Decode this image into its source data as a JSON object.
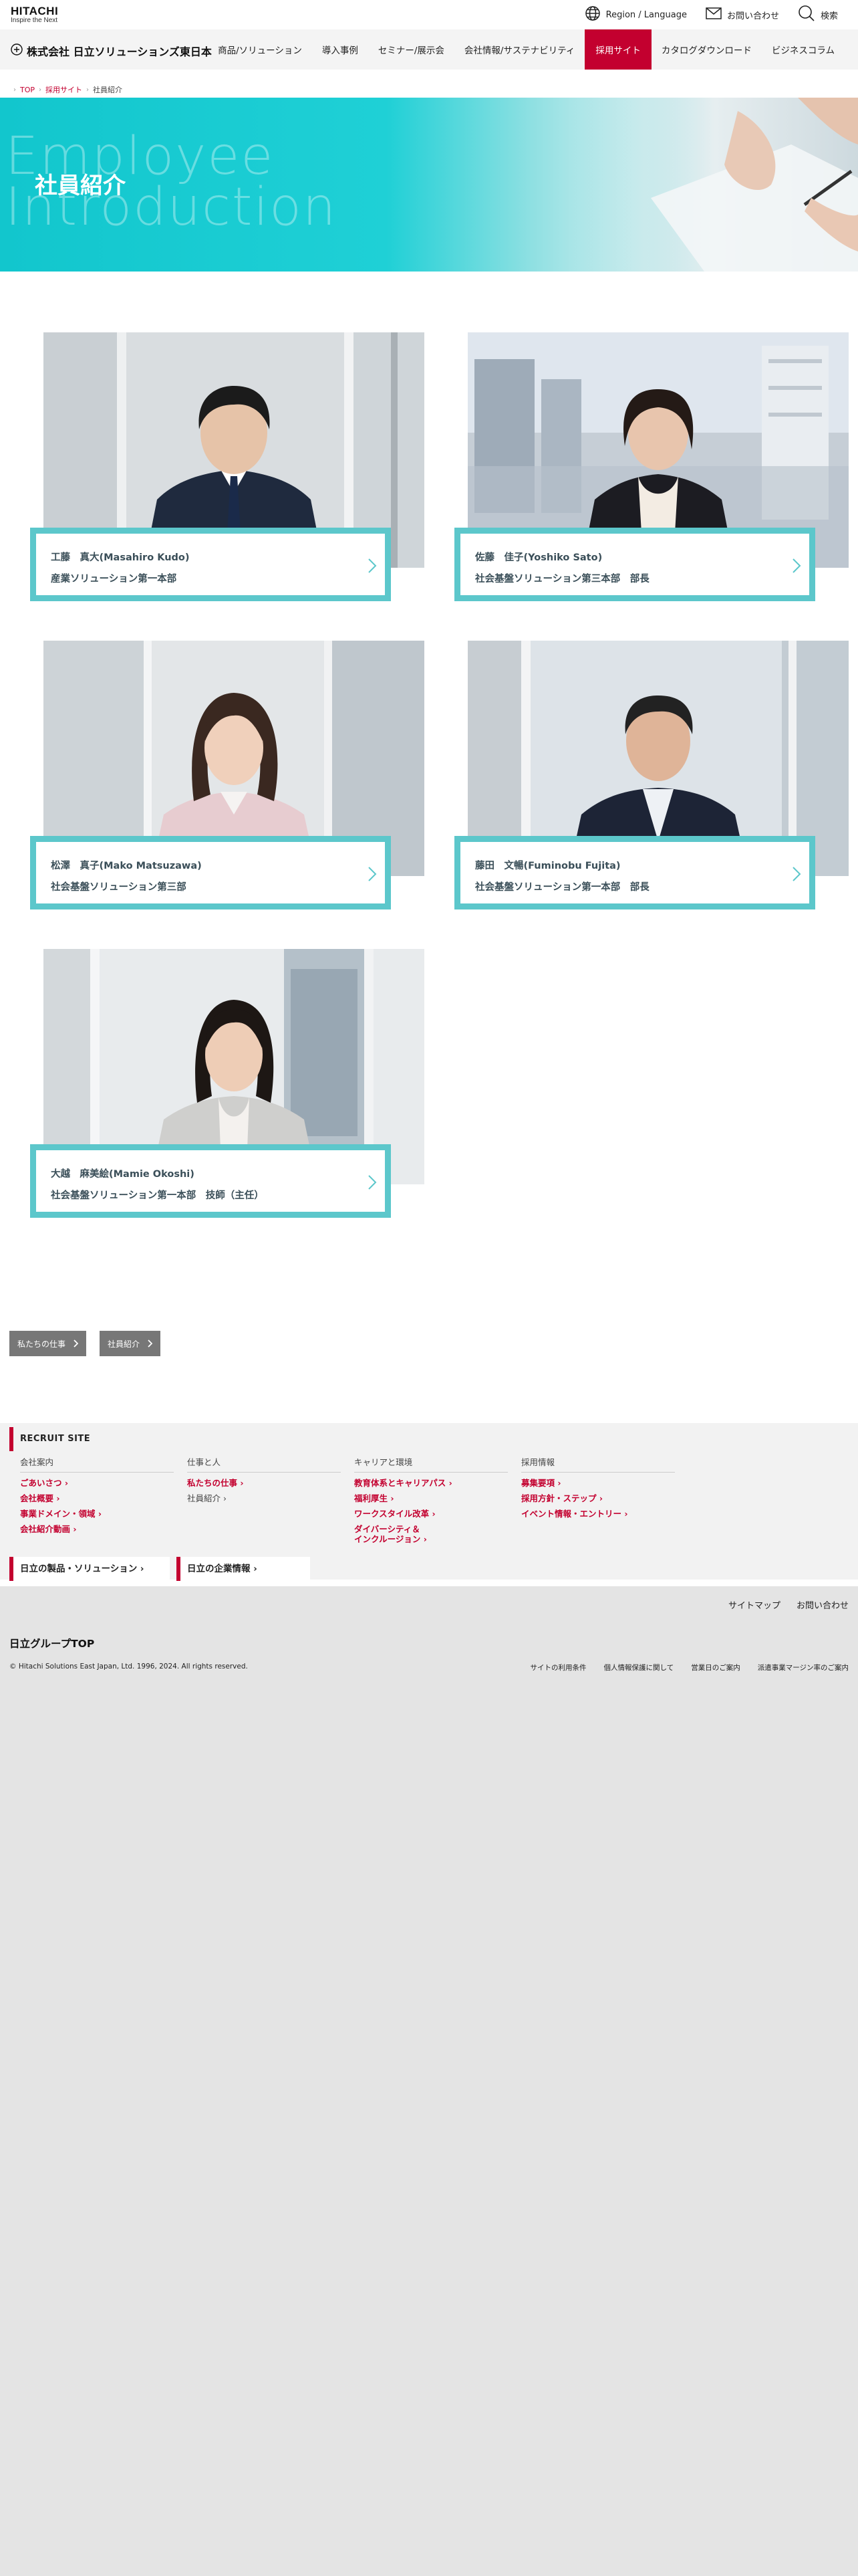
{
  "header": {
    "logo_main": "HITACHI",
    "logo_sub": "Inspire the Next",
    "utils": [
      {
        "label": "Region / Language",
        "icon": "globe-icon"
      },
      {
        "label": "お問い合わせ",
        "icon": "mail-icon"
      },
      {
        "label": "検索",
        "icon": "search-icon"
      }
    ]
  },
  "nav": {
    "company": "株式会社 日立ソリューションズ東日本",
    "items": [
      {
        "label": "商品/ソリューション"
      },
      {
        "label": "導入事例"
      },
      {
        "label": "セミナー/展示会"
      },
      {
        "label": "会社情報/サステナビリティ"
      },
      {
        "label": "採用サイト",
        "active": true
      },
      {
        "label": "カタログダウンロード"
      },
      {
        "label": "ビジネスコラム"
      }
    ]
  },
  "breadcrumb": [
    "TOP",
    "採用サイト",
    "社員紹介"
  ],
  "hero": {
    "en_line1": "Employee",
    "en_line2": "Introduction",
    "title": "社員紹介"
  },
  "staff": [
    {
      "name": "工藤　真大(Masahiro Kudo)",
      "dept": "産業ソリューション第一本部"
    },
    {
      "name": "佐藤　佳子(Yoshiko Sato)",
      "dept": "社会基盤ソリューション第三本部　部長"
    },
    {
      "name": "松澤　真子(Mako Matsuzawa)",
      "dept": "社会基盤ソリューション第三部"
    },
    {
      "name": "藤田　文暢(Fuminobu Fujita)",
      "dept": "社会基盤ソリューション第一本部　部長"
    },
    {
      "name": "大越　麻美絵(Mamie Okoshi)",
      "dept": "社会基盤ソリューション第一本部　技師（主任）"
    }
  ],
  "subnav": [
    "私たちの仕事",
    "社員紹介"
  ],
  "recruit": {
    "heading": "RECRUIT SITE",
    "columns": [
      {
        "title": "会社案内",
        "links": [
          "ごあいさつ",
          "会社概要",
          "事業ドメイン・領域",
          "会社紹介動画"
        ]
      },
      {
        "title": "仕事と人",
        "links": [
          "私たちの仕事",
          "社員紹介"
        ]
      },
      {
        "title": "キャリアと環境",
        "links": [
          "教育体系とキャリアパス",
          "福利厚生",
          "ワークスタイル改革",
          "ダイバーシティ＆",
          "インクルージョン"
        ]
      },
      {
        "title": "採用情報",
        "links": [
          "募集要項",
          "採用方針・ステップ",
          "イベント情報・エントリー"
        ]
      }
    ],
    "bottom_links": [
      "日立の製品・ソリューション",
      "日立の企業情報"
    ]
  },
  "footer": {
    "site_links": [
      "サイトマップ",
      "お問い合わせ"
    ],
    "group_top": "日立グループTOP",
    "copyright": "© Hitachi Solutions East Japan, Ltd. 1996, 2024. All rights reserved.",
    "legal_links": [
      "サイトの利用条件",
      "個人情報保護に関して",
      "営業日のご案内",
      "派遣事業マージン率のご案内"
    ]
  },
  "colors": {
    "brand_red": "#c3002f",
    "teal": "#5cc7cb",
    "hero_teal": "#12c6cd"
  }
}
